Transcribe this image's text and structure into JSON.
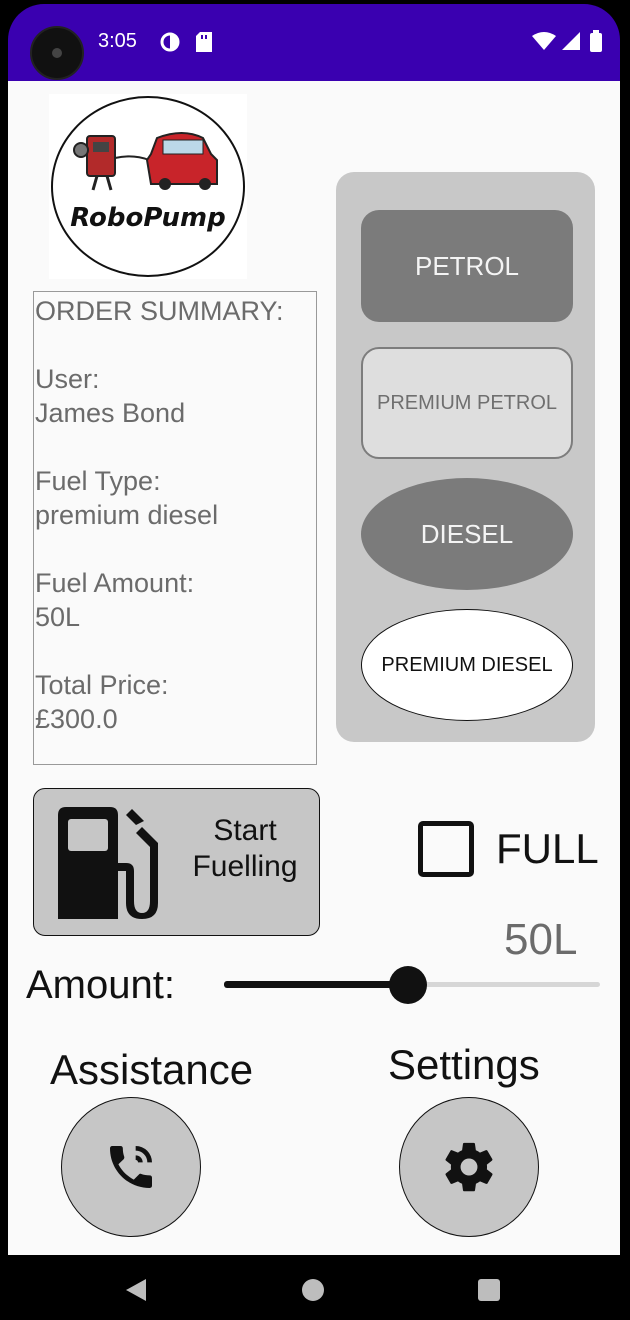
{
  "status_bar": {
    "time": "3:05"
  },
  "logo": {
    "text": "RoboPump"
  },
  "order_summary": {
    "heading": "ORDER SUMMARY:",
    "user_label": "User:",
    "user_value": "James Bond",
    "fuel_type_label": "Fuel Type:",
    "fuel_type_value": "premium diesel",
    "fuel_amount_label": "Fuel Amount:",
    "fuel_amount_value": "50L",
    "total_price_label": "Total Price:",
    "total_price_value": "£300.0"
  },
  "fuel_options": {
    "petrol": "PETROL",
    "premium_petrol": "PREMIUM PETROL",
    "diesel": "DIESEL",
    "premium_diesel": "PREMIUM DIESEL",
    "selected": "premium_diesel"
  },
  "start_button": {
    "line1": "Start",
    "line2": "Fuelling"
  },
  "full_checkbox": {
    "label": "FULL",
    "checked": false
  },
  "amount": {
    "label": "Amount:",
    "display": "50L",
    "slider_fraction": 0.49
  },
  "assistance": {
    "label": "Assistance",
    "icon": "phone-call-icon"
  },
  "settings": {
    "label": "Settings",
    "icon": "gear-icon"
  },
  "colors": {
    "status_bar": "#3a00b0",
    "panel": "#c8c8c8",
    "button_dark": "#7b7b7b"
  }
}
